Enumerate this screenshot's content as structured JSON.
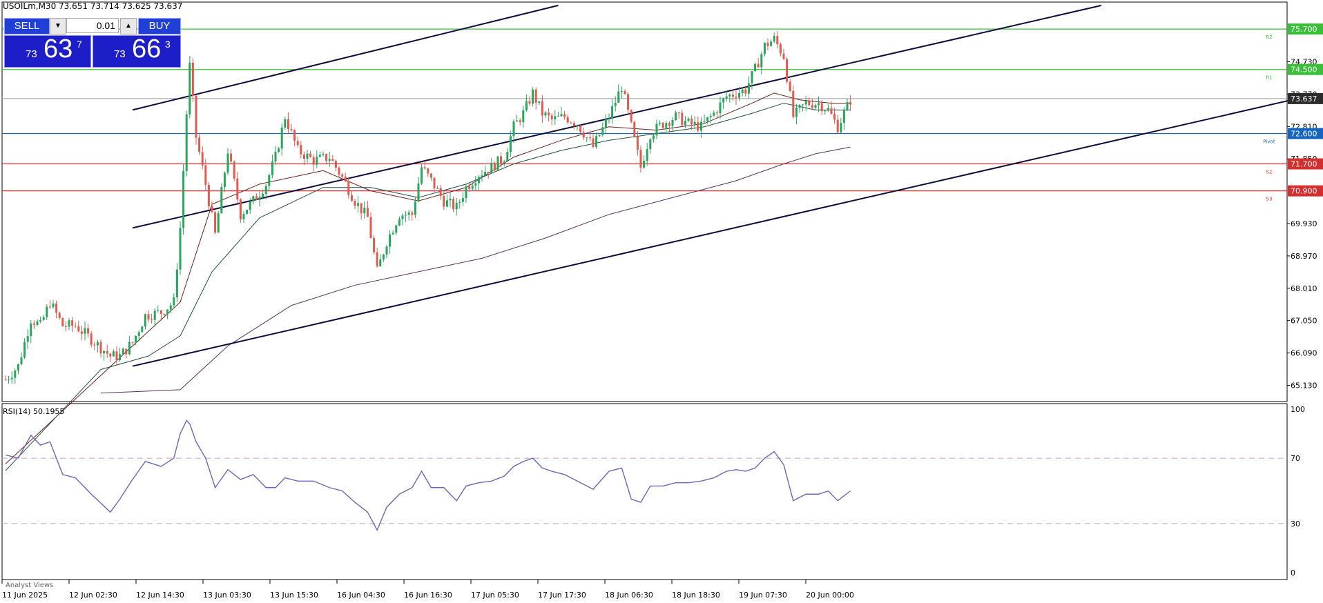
{
  "header": {
    "text": "USOILm,M30  73.651 73.714 73.625 73.637"
  },
  "trade_panel": {
    "sell_label": "SELL",
    "buy_label": "BUY",
    "lot": "0.01",
    "lot_down_icon": "triangle-down-icon",
    "lot_up_icon": "triangle-up-icon",
    "sell_price": {
      "small": "73",
      "big": "63",
      "sup": "7"
    },
    "buy_price": {
      "small": "73",
      "big": "66",
      "sup": "3"
    }
  },
  "rsi_label": "RSI(14) 50.1955",
  "analyst_label": "Analyst Views",
  "chart_data": {
    "type": "candlestick",
    "price_axis": {
      "min": 64.65,
      "max": 76.5,
      "ticks": [
        "74.730",
        "73.770",
        "72.810",
        "71.850",
        "69.930",
        "68.970",
        "68.010",
        "67.050",
        "66.090",
        "65.130"
      ]
    },
    "time_labels": [
      "11 Jun 2025",
      "12 Jun 02:30",
      "12 Jun 14:30",
      "13 Jun 03:30",
      "13 Jun 15:30",
      "16 Jun 04:30",
      "16 Jun 16:30",
      "17 Jun 05:30",
      "17 Jun 17:30",
      "18 Jun 06:30",
      "18 Jun 18:30",
      "19 Jun 07:30",
      "20 Jun 00:00"
    ],
    "price_path": [
      [
        0,
        65.3
      ],
      [
        4,
        65.7
      ],
      [
        8,
        67.1
      ],
      [
        11,
        66.9
      ],
      [
        14,
        67.6
      ],
      [
        18,
        66.9
      ],
      [
        22,
        66.9
      ],
      [
        27,
        66.5
      ],
      [
        33,
        66.0
      ],
      [
        36,
        66.0
      ],
      [
        40,
        66.4
      ],
      [
        44,
        67.2
      ],
      [
        49,
        67.3
      ],
      [
        53,
        67.6
      ],
      [
        55,
        69.8
      ],
      [
        57,
        73.2
      ],
      [
        58,
        74.6
      ],
      [
        60,
        72.5
      ],
      [
        63,
        71.1
      ],
      [
        66,
        69.6
      ],
      [
        70,
        72.1
      ],
      [
        74,
        70.2
      ],
      [
        78,
        70.6
      ],
      [
        82,
        71.1
      ],
      [
        85,
        71.9
      ],
      [
        88,
        73.1
      ],
      [
        92,
        72.1
      ],
      [
        97,
        71.8
      ],
      [
        102,
        71.9
      ],
      [
        106,
        71.3
      ],
      [
        110,
        70.6
      ],
      [
        114,
        70.1
      ],
      [
        117,
        68.5
      ],
      [
        120,
        69.4
      ],
      [
        124,
        70.2
      ],
      [
        128,
        70.2
      ],
      [
        131,
        71.6
      ],
      [
        134,
        71.2
      ],
      [
        138,
        70.6
      ],
      [
        142,
        70.4
      ],
      [
        145,
        71.0
      ],
      [
        149,
        71.4
      ],
      [
        153,
        71.6
      ],
      [
        157,
        71.9
      ],
      [
        160,
        72.8
      ],
      [
        163,
        73.2
      ],
      [
        166,
        73.8
      ],
      [
        169,
        73.2
      ],
      [
        172,
        73.0
      ],
      [
        176,
        73.1
      ],
      [
        180,
        72.9
      ],
      [
        185,
        72.2
      ],
      [
        190,
        73.1
      ],
      [
        194,
        74.0
      ],
      [
        197,
        72.8
      ],
      [
        200,
        71.6
      ],
      [
        203,
        72.6
      ],
      [
        207,
        72.9
      ],
      [
        211,
        73.1
      ],
      [
        215,
        72.9
      ],
      [
        219,
        72.8
      ],
      [
        223,
        73.2
      ],
      [
        227,
        73.7
      ],
      [
        230,
        73.8
      ],
      [
        233,
        73.9
      ],
      [
        236,
        74.5
      ],
      [
        239,
        75.2
      ],
      [
        242,
        75.4
      ],
      [
        245,
        74.9
      ],
      [
        248,
        73.1
      ],
      [
        252,
        73.5
      ],
      [
        256,
        73.5
      ],
      [
        259,
        73.3
      ],
      [
        262,
        72.8
      ],
      [
        266,
        73.6
      ]
    ],
    "price_count": 267,
    "moving_averages": [
      {
        "color": "#6b1f1f",
        "path": [
          [
            0,
            62.8
          ],
          [
            40,
            66.3
          ],
          [
            55,
            67.6
          ],
          [
            65,
            70.5
          ],
          [
            80,
            71.1
          ],
          [
            100,
            71.5
          ],
          [
            115,
            70.9
          ],
          [
            130,
            70.6
          ],
          [
            145,
            71.0
          ],
          [
            160,
            71.9
          ],
          [
            175,
            72.4
          ],
          [
            190,
            72.8
          ],
          [
            205,
            72.7
          ],
          [
            220,
            72.9
          ],
          [
            235,
            73.5
          ],
          [
            242,
            73.8
          ],
          [
            250,
            73.6
          ],
          [
            260,
            73.5
          ],
          [
            266,
            73.5
          ]
        ]
      },
      {
        "color": "#1f4f3f",
        "path": [
          [
            0,
            62.6
          ],
          [
            30,
            65.6
          ],
          [
            45,
            66.0
          ],
          [
            55,
            66.6
          ],
          [
            65,
            68.5
          ],
          [
            80,
            70.1
          ],
          [
            100,
            71.0
          ],
          [
            115,
            71.0
          ],
          [
            130,
            70.7
          ],
          [
            145,
            71.1
          ],
          [
            160,
            71.7
          ],
          [
            175,
            72.1
          ],
          [
            190,
            72.4
          ],
          [
            205,
            72.6
          ],
          [
            220,
            72.8
          ],
          [
            235,
            73.2
          ],
          [
            245,
            73.5
          ],
          [
            255,
            73.3
          ],
          [
            266,
            73.3
          ]
        ]
      },
      {
        "color": "#5a2f5a",
        "path": [
          [
            30,
            64.9
          ],
          [
            55,
            65.0
          ],
          [
            70,
            66.3
          ],
          [
            90,
            67.5
          ],
          [
            110,
            68.1
          ],
          [
            130,
            68.5
          ],
          [
            150,
            68.9
          ],
          [
            170,
            69.5
          ],
          [
            190,
            70.2
          ],
          [
            210,
            70.7
          ],
          [
            230,
            71.2
          ],
          [
            245,
            71.7
          ],
          [
            255,
            72.0
          ],
          [
            266,
            72.2
          ]
        ]
      }
    ],
    "levels": [
      {
        "value": 75.7,
        "label": "75.700",
        "color": "#3bbf3b",
        "tag": "R2"
      },
      {
        "value": 74.5,
        "label": "74.500",
        "color": "#3bbf3b",
        "tag": "R1"
      },
      {
        "value": 72.6,
        "label": "72.600",
        "color": "#1565c0",
        "tag": "Pivot"
      },
      {
        "value": 71.7,
        "label": "71.700",
        "color": "#d32f2f",
        "tag": "S2"
      },
      {
        "value": 70.9,
        "label": "70.900",
        "color": "#d32f2f",
        "tag": "S3"
      }
    ],
    "current_price": {
      "value": 73.637,
      "label": "73.637"
    },
    "trendlines": [
      {
        "from": [
          40,
          73.3
        ],
        "to": [
          174,
          76.4
        ]
      },
      {
        "from": [
          40,
          69.8
        ],
        "to": [
          345,
          76.4
        ]
      },
      {
        "from": [
          40,
          65.7
        ],
        "to": [
          405,
          73.6
        ]
      }
    ],
    "rsi": {
      "min": 0,
      "max": 100,
      "levels": [
        70,
        30
      ],
      "ticks": [
        "100",
        "70",
        "30",
        "0"
      ],
      "color": "#6f64b5",
      "path": [
        [
          0,
          72
        ],
        [
          4,
          70
        ],
        [
          8,
          84
        ],
        [
          11,
          78
        ],
        [
          14,
          80
        ],
        [
          18,
          60
        ],
        [
          22,
          58
        ],
        [
          27,
          48
        ],
        [
          33,
          37
        ],
        [
          36,
          45
        ],
        [
          40,
          57
        ],
        [
          44,
          68
        ],
        [
          49,
          65
        ],
        [
          53,
          70
        ],
        [
          55,
          85
        ],
        [
          57,
          93
        ],
        [
          58,
          91
        ],
        [
          60,
          80
        ],
        [
          63,
          70
        ],
        [
          66,
          52
        ],
        [
          70,
          63
        ],
        [
          74,
          57
        ],
        [
          78,
          60
        ],
        [
          82,
          52
        ],
        [
          85,
          52
        ],
        [
          88,
          58
        ],
        [
          92,
          56
        ],
        [
          97,
          56
        ],
        [
          102,
          52
        ],
        [
          106,
          50
        ],
        [
          110,
          43
        ],
        [
          114,
          37
        ],
        [
          117,
          26
        ],
        [
          120,
          40
        ],
        [
          124,
          48
        ],
        [
          128,
          52
        ],
        [
          131,
          62
        ],
        [
          134,
          52
        ],
        [
          138,
          52
        ],
        [
          142,
          44
        ],
        [
          145,
          53
        ],
        [
          149,
          55
        ],
        [
          153,
          56
        ],
        [
          157,
          59
        ],
        [
          160,
          65
        ],
        [
          163,
          68
        ],
        [
          166,
          70
        ],
        [
          169,
          64
        ],
        [
          172,
          62
        ],
        [
          176,
          60
        ],
        [
          180,
          56
        ],
        [
          185,
          51
        ],
        [
          190,
          62
        ],
        [
          194,
          64
        ],
        [
          197,
          45
        ],
        [
          200,
          43
        ],
        [
          203,
          53
        ],
        [
          207,
          53
        ],
        [
          211,
          55
        ],
        [
          215,
          55
        ],
        [
          219,
          56
        ],
        [
          223,
          58
        ],
        [
          227,
          62
        ],
        [
          230,
          63
        ],
        [
          233,
          62
        ],
        [
          236,
          64
        ],
        [
          239,
          70
        ],
        [
          242,
          74
        ],
        [
          245,
          66
        ],
        [
          248,
          44
        ],
        [
          252,
          48
        ],
        [
          256,
          48
        ],
        [
          259,
          50
        ],
        [
          262,
          44
        ],
        [
          266,
          50
        ]
      ]
    }
  }
}
